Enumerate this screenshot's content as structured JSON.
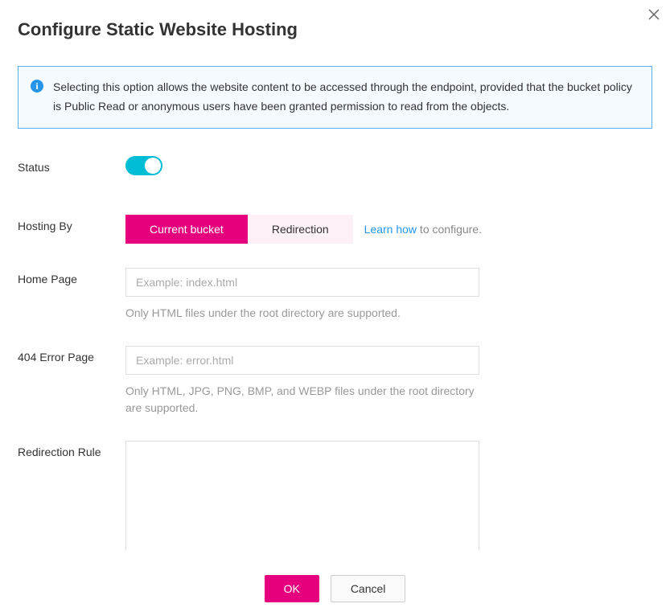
{
  "title": "Configure Static Website Hosting",
  "info_text": "Selecting this option allows the website content to be accessed through the endpoint, provided that the bucket policy is Public Read or anonymous users have been granted permission to read from the objects.",
  "labels": {
    "status": "Status",
    "hosting_by": "Hosting By",
    "home_page": "Home Page",
    "error_page": "404 Error Page",
    "redirection_rule": "Redirection Rule"
  },
  "tabs": {
    "current_bucket": "Current bucket",
    "redirection": "Redirection"
  },
  "learn_how": {
    "link": "Learn how",
    "tail": " to configure."
  },
  "home_page": {
    "value": "",
    "placeholder": "Example: index.html",
    "hint": "Only HTML files under the root directory are supported."
  },
  "error_page": {
    "value": "",
    "placeholder": "Example: error.html",
    "hint": "Only HTML, JPG, PNG, BMP, and WEBP files under the root directory are supported."
  },
  "redirection_rule": {
    "value": ""
  },
  "buttons": {
    "ok": "OK",
    "cancel": "Cancel"
  }
}
